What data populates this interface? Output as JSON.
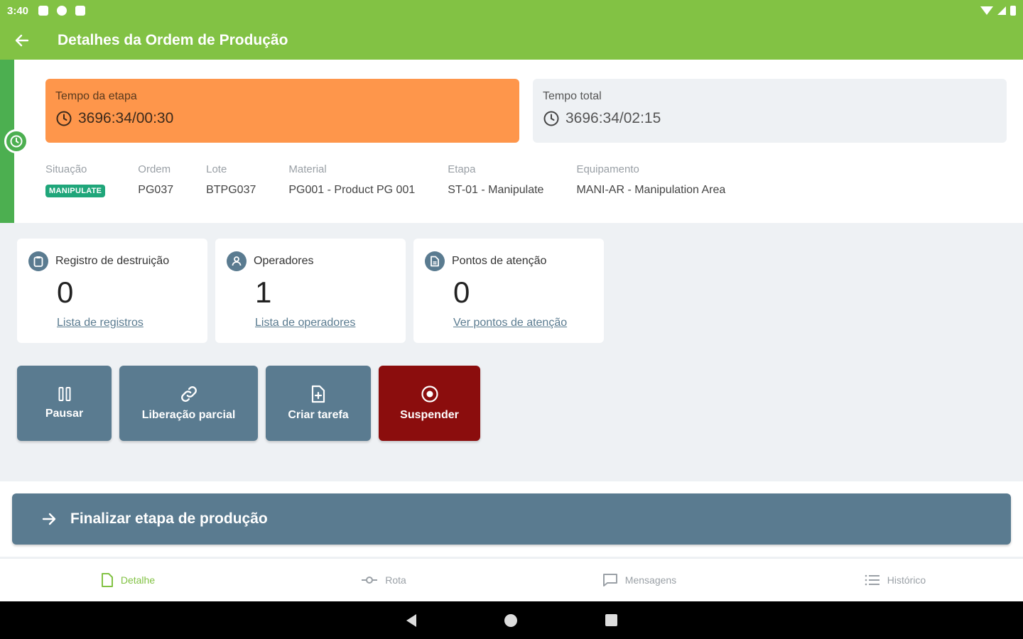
{
  "status_bar": {
    "time": "3:40"
  },
  "app_bar": {
    "title": "Detalhes da Ordem de Produção"
  },
  "timers": {
    "stage": {
      "label": "Tempo da etapa",
      "value": "3696:34/00:30"
    },
    "total": {
      "label": "Tempo total",
      "value": "3696:34/02:15"
    }
  },
  "info": [
    {
      "label": "Situação",
      "value": "MANIPULATE"
    },
    {
      "label": "Ordem",
      "value": "PG037"
    },
    {
      "label": "Lote",
      "value": "BTPG037"
    },
    {
      "label": "Material",
      "value": "PG001 - Product PG 001"
    },
    {
      "label": "Etapa",
      "value": "ST-01 - Manipulate"
    },
    {
      "label": "Equipamento",
      "value": "MANI-AR - Manipulation Area"
    }
  ],
  "stats": [
    {
      "title": "Registro de destruição",
      "count": "0",
      "link": "Lista de registros",
      "icon": "clipboard-icon"
    },
    {
      "title": "Operadores",
      "count": "1",
      "link": "Lista de operadores",
      "icon": "person-icon"
    },
    {
      "title": "Pontos de atenção",
      "count": "0",
      "link": "Ver pontos de atenção",
      "icon": "document-icon"
    }
  ],
  "actions": {
    "pause": "Pausar",
    "partial_release": "Liberação parcial",
    "create_task": "Criar tarefa",
    "suspend": "Suspender"
  },
  "finalize": {
    "label": "Finalizar etapa de produção"
  },
  "bottom_nav": [
    {
      "label": "Detalhe",
      "icon": "file-icon",
      "active": true
    },
    {
      "label": "Rota",
      "icon": "route-icon",
      "active": false
    },
    {
      "label": "Mensagens",
      "icon": "message-icon",
      "active": false
    },
    {
      "label": "Histórico",
      "icon": "list-icon",
      "active": false
    }
  ],
  "colors": {
    "app_bar": "#82c244",
    "stage_timer": "#fe964b",
    "status_badge": "#1fa67a",
    "action_button": "#5a7b90",
    "suspend_button": "#8b0d0d"
  }
}
